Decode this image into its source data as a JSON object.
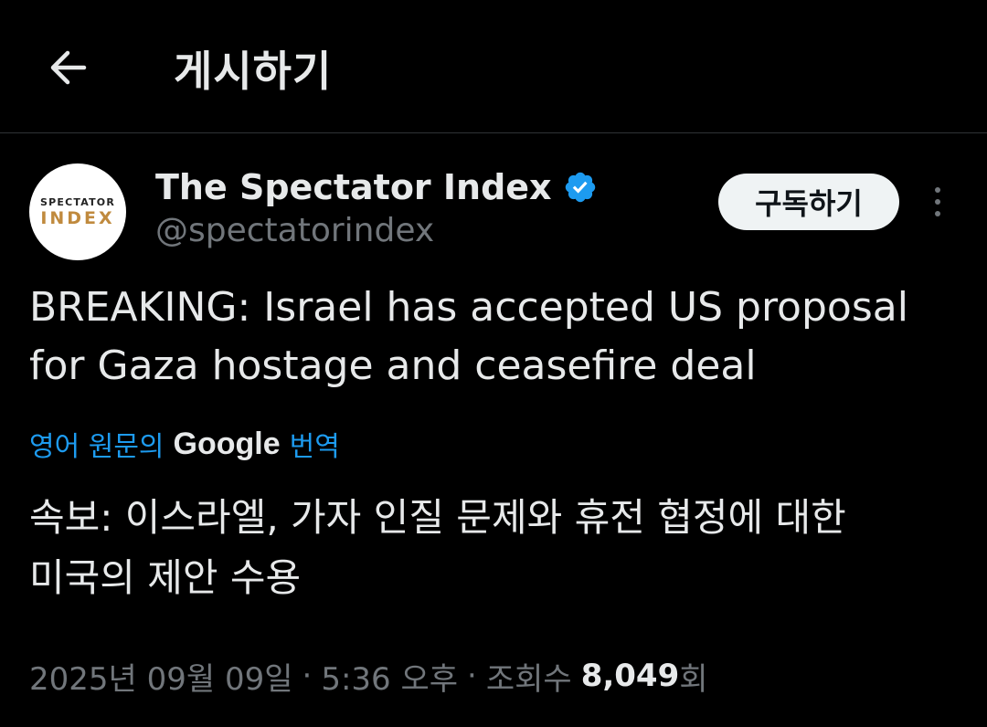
{
  "header": {
    "back_icon": "arrow-left-icon",
    "title": "게시하기"
  },
  "author": {
    "avatar": {
      "top_text": "SPECTATOR",
      "bottom_text": "INDEX"
    },
    "display_name": "The Spectator Index",
    "verified_icon": "verified-badge-icon",
    "verified_color": "#1d9bf0",
    "handle": "@spectatorindex"
  },
  "actions": {
    "subscribe_label": "구독하기",
    "more_icon": "more-vertical-icon"
  },
  "tweet": {
    "text_line1": "BREAKING: Israel has accepted US proposal",
    "text_line2": "for Gaza hostage and ceasefire deal"
  },
  "translation": {
    "prefix": "영어 원문의",
    "provider": "Google",
    "suffix": "번역",
    "text_line1": "속보: 이스라엘, 가자 인질 문제와 휴전 협정에 대한",
    "text_line2": "미국의 제안 수용"
  },
  "meta": {
    "date": "2025년 09월 09일",
    "separator": "·",
    "time": "5:36 오후",
    "views_label": "조회수",
    "views_count": "8,049",
    "views_suffix": "회"
  },
  "colors": {
    "background": "#000000",
    "accent": "#1d9bf0",
    "text_primary": "#e7e9ea",
    "text_secondary": "#71767b"
  }
}
